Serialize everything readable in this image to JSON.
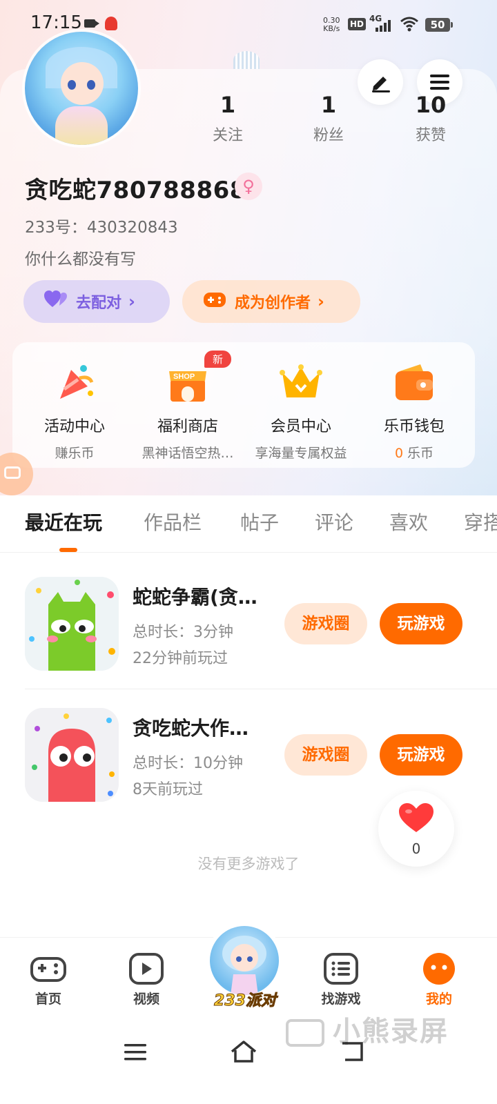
{
  "status_bar": {
    "time": "17:15",
    "speed_top": "0.30",
    "speed_unit": "KB/s",
    "hd": "HD",
    "network": "4G",
    "battery": "50"
  },
  "profile": {
    "stats": [
      {
        "value": "1",
        "label": "关注"
      },
      {
        "value": "1",
        "label": "粉丝"
      },
      {
        "value": "10",
        "label": "获赞"
      }
    ],
    "username": "贪吃蛇780788868",
    "gender_symbol": "♀",
    "uid_text": "233号：430320843",
    "bio": "你什么都没有写",
    "match_button": "去配对",
    "creator_button": "成为创作者"
  },
  "services": [
    {
      "name": "活动中心",
      "sub": "赚乐币",
      "icon": "party-popper-icon"
    },
    {
      "name": "福利商店",
      "sub": "黑神话悟空热…",
      "icon": "shop-icon",
      "badge": "新"
    },
    {
      "name": "会员中心",
      "sub": "享海量专属权益",
      "icon": "crown-icon"
    },
    {
      "name": "乐币钱包",
      "sub_value": "0",
      "sub": "乐币",
      "icon": "wallet-icon"
    }
  ],
  "tabs": [
    "最近在玩",
    "作品栏",
    "帖子",
    "评论",
    "喜欢",
    "穿搭"
  ],
  "games": [
    {
      "title": "蛇蛇争霸(贪…",
      "duration": "总时长：3分钟",
      "last_played": "22分钟前玩过",
      "circle_btn": "游戏圈",
      "play_btn": "玩游戏"
    },
    {
      "title": "贪吃蛇大作…",
      "duration": "总时长：10分钟",
      "last_played": "8天前玩过",
      "circle_btn": "游戏圈",
      "play_btn": "玩游戏"
    }
  ],
  "no_more_text": "没有更多游戏了",
  "like_count": "0",
  "bottom_nav": [
    {
      "label": "首页",
      "icon": "gamepad-icon"
    },
    {
      "label": "视频",
      "icon": "play-icon"
    },
    {
      "label": "233派对",
      "icon": "party-avatar-icon"
    },
    {
      "label": "找游戏",
      "icon": "list-icon"
    },
    {
      "label": "我的",
      "icon": "profile-face-icon"
    }
  ],
  "watermark": "小熊录屏",
  "colors": {
    "accent": "#ff6a00",
    "purple": "#7c5fe0",
    "badge_red": "#f0443f"
  }
}
